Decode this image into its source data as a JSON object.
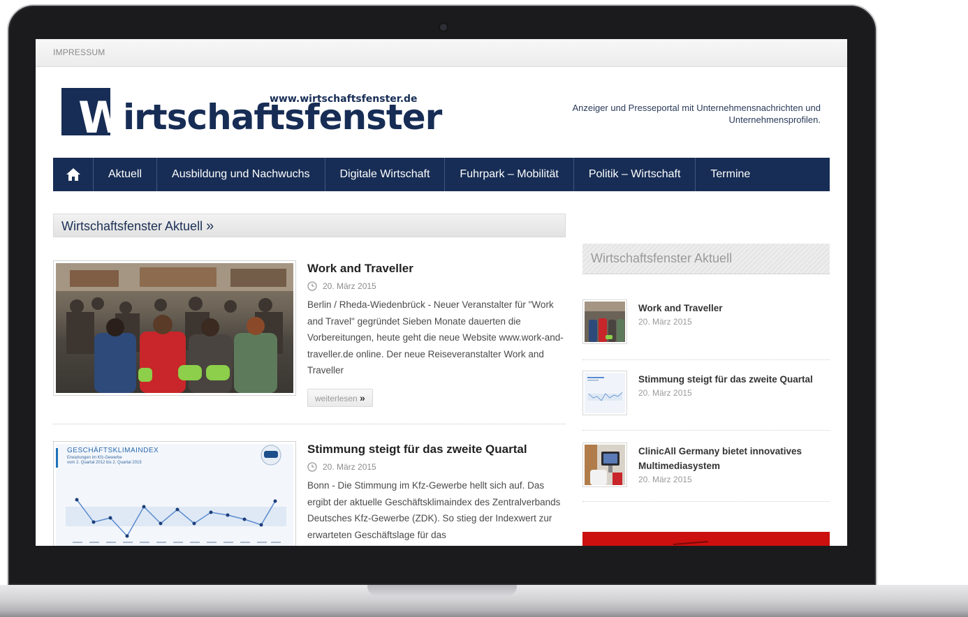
{
  "topbar": {
    "impressum": "IMPRESSUM"
  },
  "logo": {
    "w_letter": "W",
    "rest": "irtschaftsfenster",
    "url": "www.wirtschaftsfenster.de"
  },
  "tagline": "Anzeiger und Presseportal mit Unternehmensnachrichten und Unternehmensprofilen.",
  "nav": {
    "home_icon": "home-icon",
    "items": [
      "Aktuell",
      "Ausbildung und Nachwuchs",
      "Digitale Wirtschaft",
      "Fuhrpark – Mobilität",
      "Politik – Wirtschaft",
      "Termine"
    ]
  },
  "main": {
    "section_title": "Wirtschaftsfenster Aktuell",
    "section_arrow": "»",
    "articles": [
      {
        "title": "Work and Traveller",
        "date": "20. März 2015",
        "text": "Berlin / Rheda-Wiedenbrück - Neuer Veranstalter für \"Work and Travel\" gegründet Sieben Monate dauerten die Vorbereitungen, heute geht die neue Website www.work-and-traveller.de online. Der neue Reiseveranstalter Work and Traveller",
        "more_label": "weiterlesen",
        "more_arrow": "»"
      },
      {
        "title": "Stimmung steigt für das zweite Quartal",
        "date": "20. März 2015",
        "text": "Bonn - Die Stimmung im Kfz-Gewerbe hellt sich auf. Das ergibt der aktuelle Geschäftsklimaindex des Zentralverbands Deutsches Kfz-Gewerbe (ZDK). So stieg der Indexwert zur erwarteten Geschäftslage für das",
        "thumb_title": "GESCHÄFTSKLIMAINDEX",
        "thumb_sub1": "Erwartungen im Kfz-Gewerbe",
        "thumb_sub2": "vom 2. Quartal 2012 bis 2. Quartal 2015"
      }
    ]
  },
  "sidebar": {
    "title": "Wirtschaftsfenster Aktuell",
    "items": [
      {
        "title": "Work and Traveller",
        "date": "20. März 2015"
      },
      {
        "title": "Stimmung steigt für das zweite Quartal",
        "date": "20. März 2015"
      },
      {
        "title": "ClinicAll Germany bietet innovatives Multimediasystem",
        "date": "20. März 2015"
      }
    ]
  },
  "colors": {
    "brand_navy": "#172d55",
    "banner_red": "#cc1010"
  }
}
